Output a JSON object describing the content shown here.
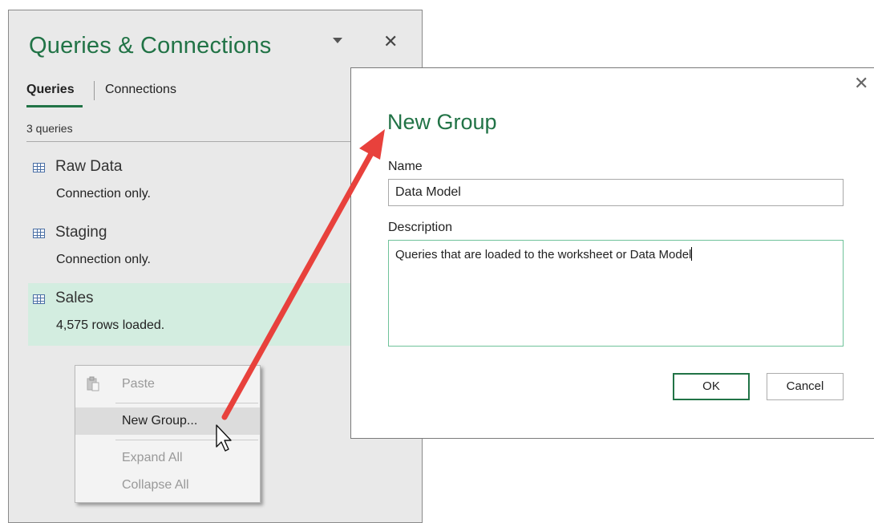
{
  "pane": {
    "title": "Queries & Connections",
    "tabs": [
      {
        "label": "Queries",
        "active": true
      },
      {
        "label": "Connections",
        "active": false
      }
    ],
    "query_count": "3 queries",
    "queries": [
      {
        "name": "Raw Data",
        "status": "Connection only.",
        "icon": "table-icon"
      },
      {
        "name": "Staging",
        "status": "Connection only.",
        "icon": "table-icon"
      },
      {
        "name": "Sales",
        "status": "4,575 rows loaded.",
        "icon": "table-icon",
        "selected": true
      }
    ]
  },
  "context_menu": {
    "items": [
      {
        "label": "Paste",
        "enabled": false,
        "icon": "paste-icon"
      },
      {
        "label": "New Group...",
        "enabled": true,
        "hovered": true
      },
      {
        "label": "Expand All",
        "enabled": false
      },
      {
        "label": "Collapse All",
        "enabled": false
      }
    ]
  },
  "dialog": {
    "title": "New Group",
    "name_label": "Name",
    "name_value": "Data Model",
    "description_label": "Description",
    "description_value": "Queries that are loaded to the worksheet or Data Model",
    "ok_label": "OK",
    "cancel_label": "Cancel"
  },
  "colors": {
    "accent": "#217346",
    "selected_row": "#d3ede0",
    "annotation_arrow": "#e8413c"
  }
}
